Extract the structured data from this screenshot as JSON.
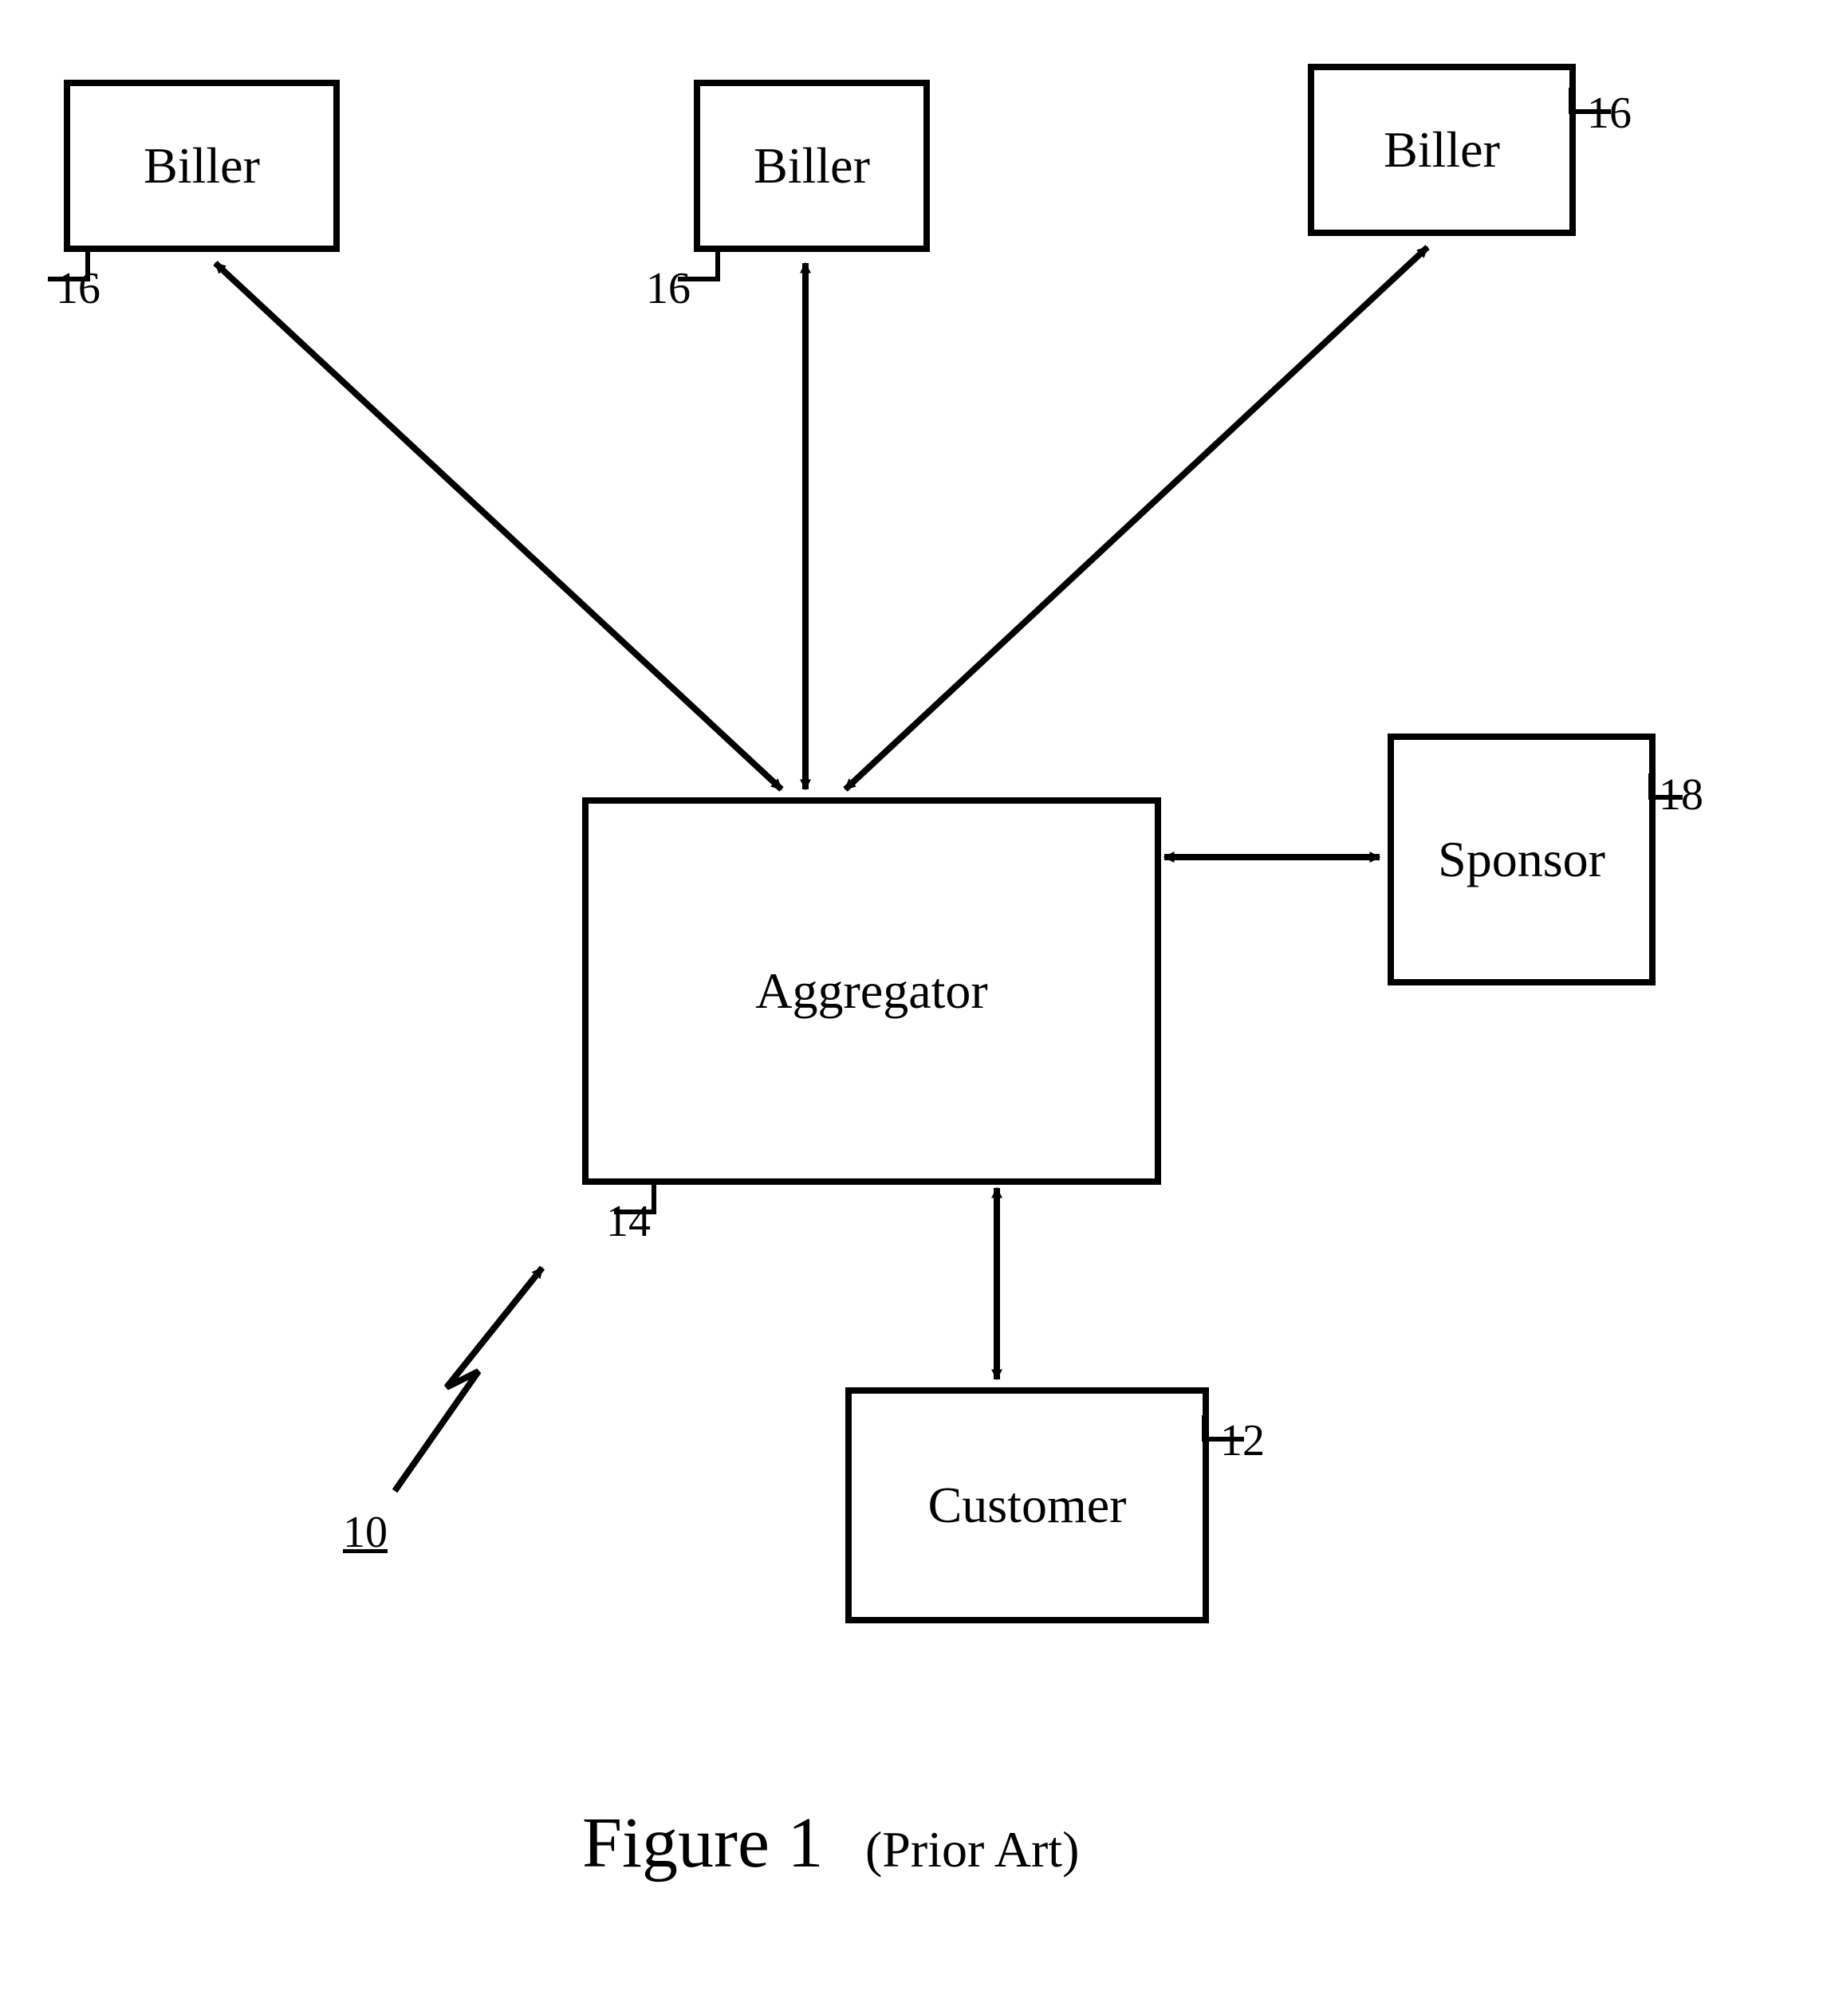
{
  "figure": {
    "title": "Figure 1",
    "subtitle": "(Prior Art)",
    "system_ref": "10"
  },
  "nodes": {
    "biller_left": {
      "label": "Biller",
      "ref": "16"
    },
    "biller_mid": {
      "label": "Biller",
      "ref": "16"
    },
    "biller_right": {
      "label": "Biller",
      "ref": "16"
    },
    "aggregator": {
      "label": "Aggregator",
      "ref": "14"
    },
    "sponsor": {
      "label": "Sponsor",
      "ref": "18"
    },
    "customer": {
      "label": "Customer",
      "ref": "12"
    }
  },
  "edges": [
    {
      "from": "biller_left",
      "to": "aggregator",
      "bidirectional": true
    },
    {
      "from": "biller_mid",
      "to": "aggregator",
      "bidirectional": true
    },
    {
      "from": "biller_right",
      "to": "aggregator",
      "bidirectional": true
    },
    {
      "from": "sponsor",
      "to": "aggregator",
      "bidirectional": true
    },
    {
      "from": "customer",
      "to": "aggregator",
      "bidirectional": true
    }
  ]
}
